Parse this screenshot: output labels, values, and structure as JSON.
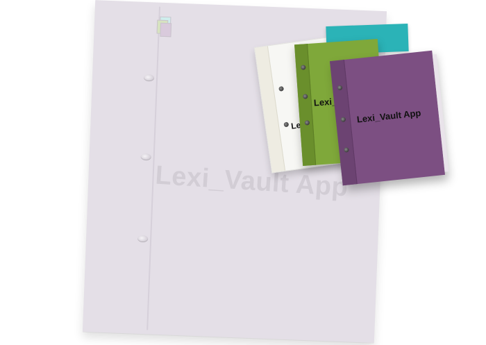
{
  "mockup": {
    "big_page_watermark": "Lexi_Vault App",
    "green_book_label": "Lexi_Vault App",
    "white_book_label": "Lexi_Vault App",
    "purple_book_label": "Lexi_Vault App"
  },
  "colors": {
    "page": "#e4dfe7",
    "teal": "#2bb3b7",
    "green": "#7fa83a",
    "purple": "#7c4f82",
    "white": "#f7f7f4"
  }
}
